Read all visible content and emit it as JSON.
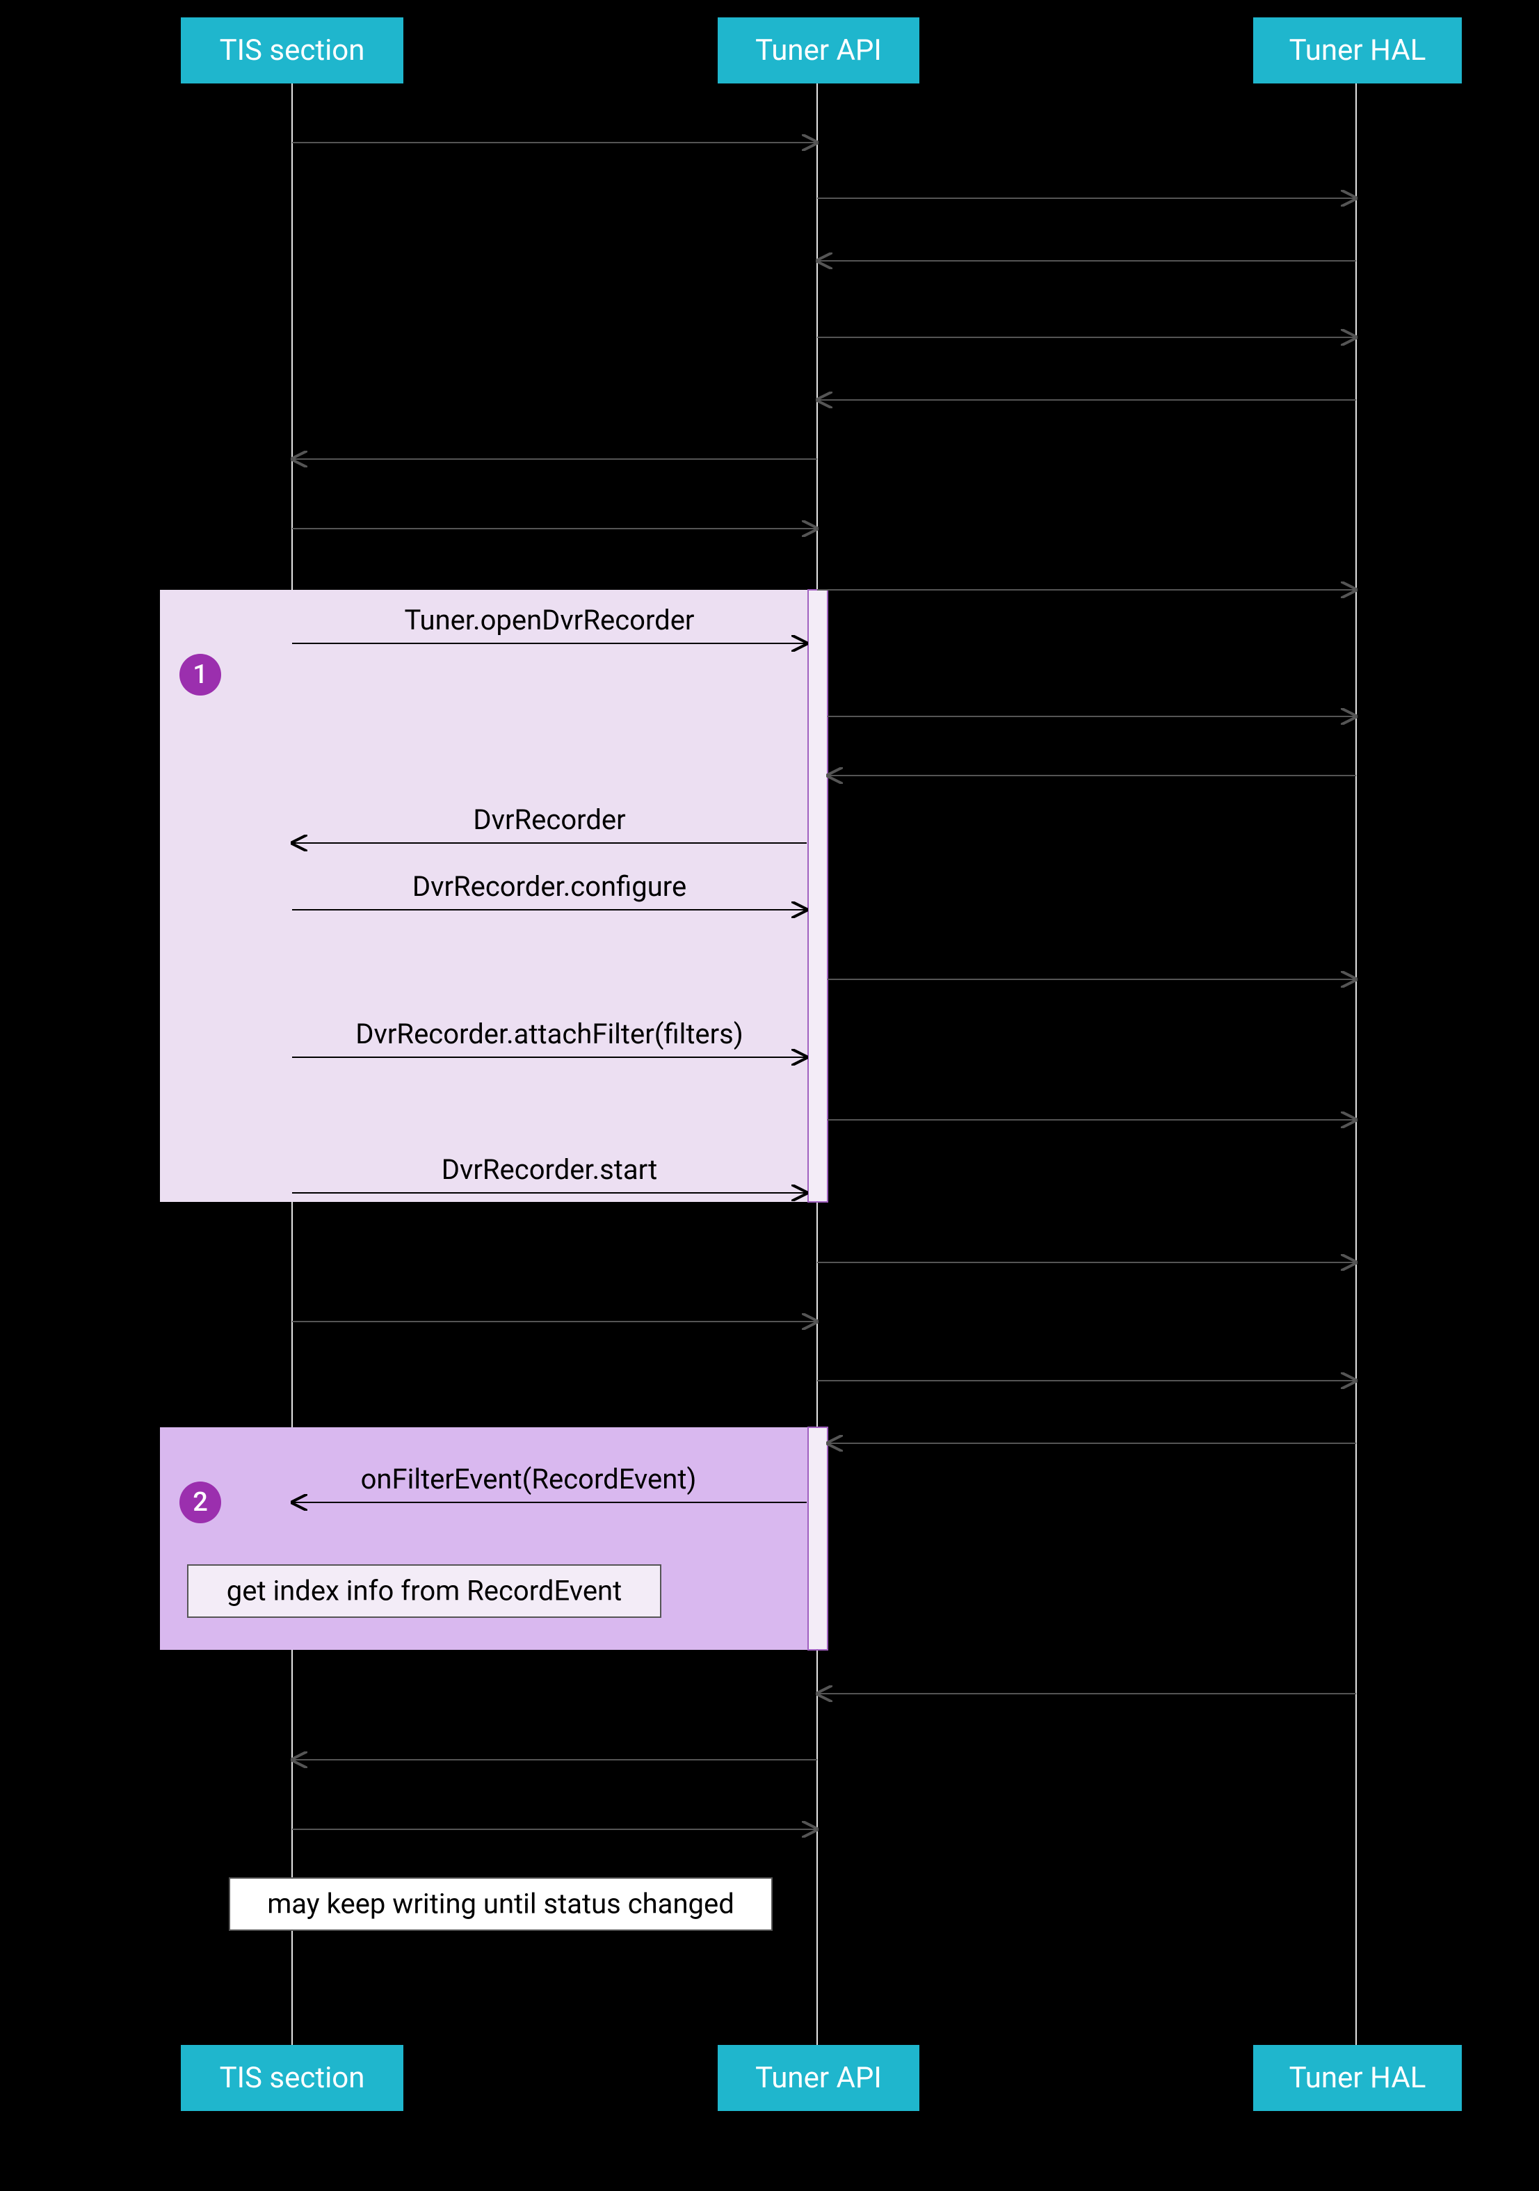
{
  "actors": {
    "tis": "TIS section",
    "api": "Tuner API",
    "hal": "Tuner HAL"
  },
  "badges": {
    "one": "1",
    "two": "2"
  },
  "messages": {
    "open_dvr": "Tuner.openDvrRecorder",
    "dvr_recorder": "DvrRecorder",
    "configure": "DvrRecorder.configure",
    "attach": "DvrRecorder.attachFilter(filters)",
    "start": "DvrRecorder.start",
    "on_filter_event": "onFilterEvent(RecordEvent)"
  },
  "notes": {
    "index_info": "get index info from RecordEvent",
    "keep_writing": "may keep writing until status changed"
  }
}
